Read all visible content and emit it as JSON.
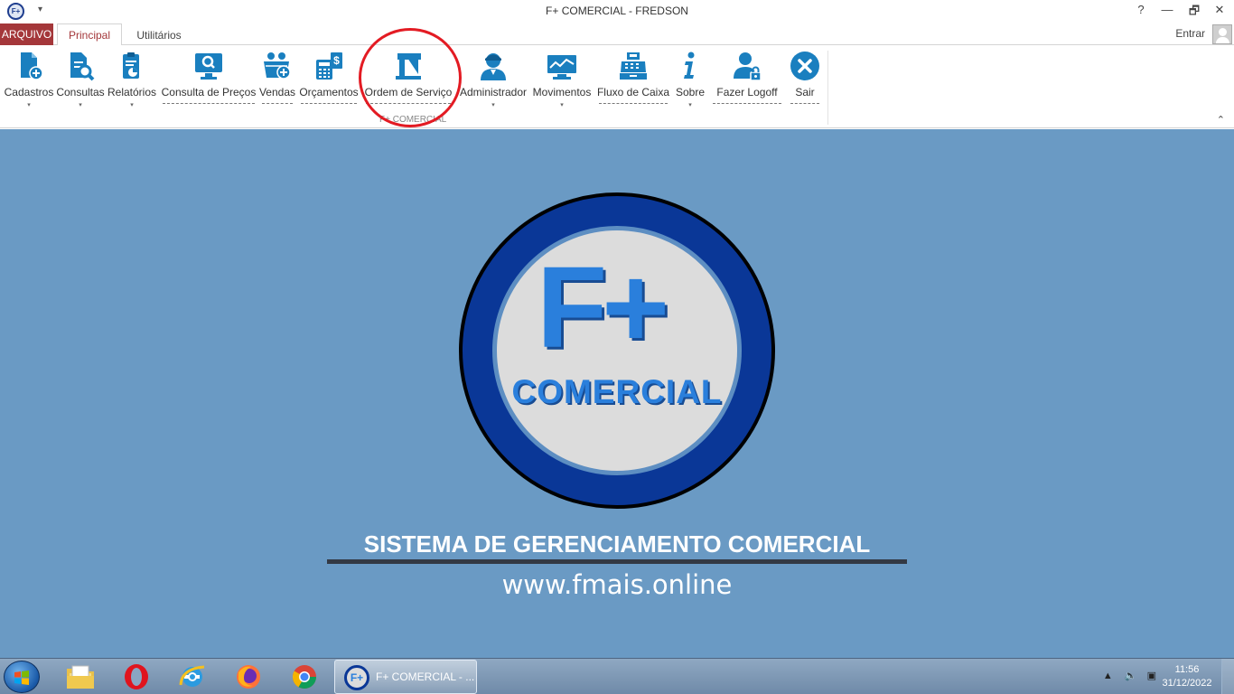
{
  "window": {
    "title": "F+ COMERCIAL - FREDSON",
    "logo_text": "F+",
    "controls": {
      "help": "?",
      "minimize": "—",
      "restore": "🗗",
      "close": "✕"
    }
  },
  "ribbon": {
    "file_tab": "ARQUIVO",
    "tabs": [
      {
        "label": "Principal",
        "active": true
      },
      {
        "label": "Utilitários",
        "active": false
      }
    ],
    "signin": "Entrar",
    "group_label": "F+ COMERCIAL",
    "buttons": [
      {
        "label": "Cadastros",
        "icon": "document-plus-icon"
      },
      {
        "label": "Consultas",
        "icon": "document-search-icon"
      },
      {
        "label": "Relatórios",
        "icon": "report-clipboard-icon"
      },
      {
        "label": "Consulta de Preços",
        "icon": "monitor-search-icon"
      },
      {
        "label": "Vendas",
        "icon": "basket-plus-icon"
      },
      {
        "label": "Orçamentos",
        "icon": "calculator-dollar-icon"
      },
      {
        "label": "Ordem de Serviço",
        "icon": "service-order-icon"
      },
      {
        "label": "Administrador",
        "icon": "admin-user-icon"
      },
      {
        "label": "Movimentos",
        "icon": "monitor-chart-icon"
      },
      {
        "label": "Fluxo de Caixa",
        "icon": "cash-register-icon"
      },
      {
        "label": "Sobre",
        "icon": "info-icon"
      },
      {
        "label": "Fazer Logoff",
        "icon": "user-lock-icon"
      },
      {
        "label": "Sair",
        "icon": "close-circle-icon"
      }
    ]
  },
  "splash": {
    "logo_mark": "F+",
    "logo_word": "COMERCIAL",
    "system_title": "SISTEMA DE GERENCIAMENTO COMERCIAL",
    "website": "www.fmais.online"
  },
  "taskbar": {
    "active_window": "F+ COMERCIAL - ...",
    "active_logo": "F+",
    "time": "11:56",
    "date": "31/12/2022"
  },
  "colors": {
    "accent": "#a4373a",
    "ribbon_icon": "#1a7fbf",
    "background": "#6a9ac4",
    "logo_ring": "#0a3797",
    "logo_text": "#2a7fdc",
    "highlight": "#e31b23"
  }
}
